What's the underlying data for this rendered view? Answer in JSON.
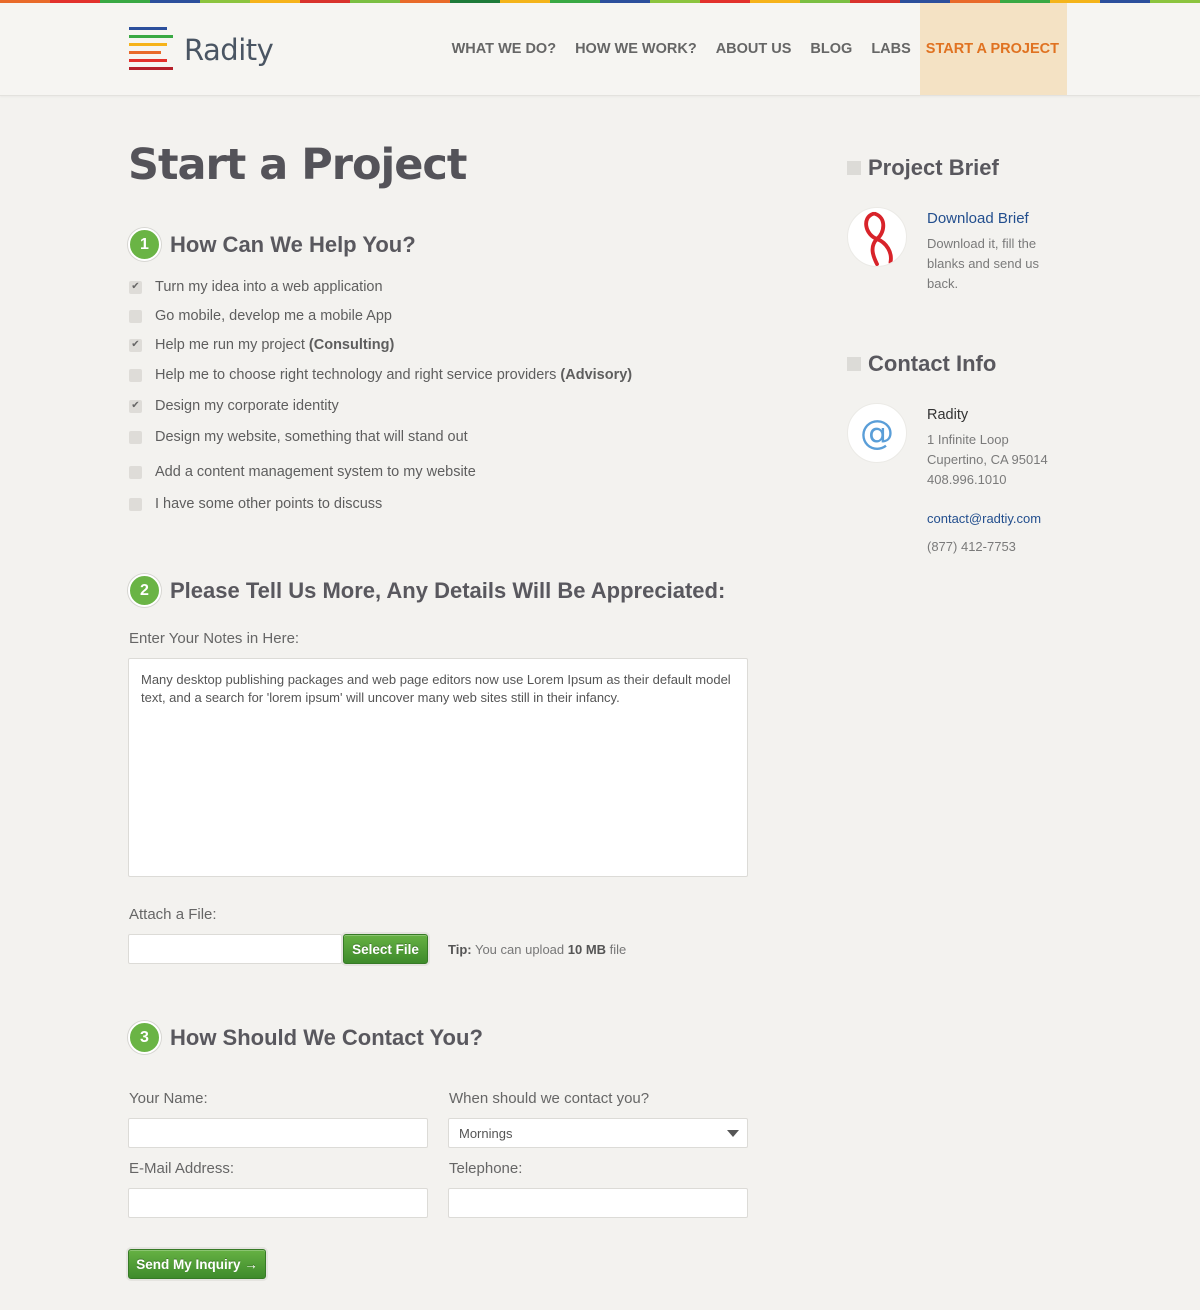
{
  "brand": {
    "name": "Radity",
    "strip_colors": [
      "#e96a2a",
      "#e3312c",
      "#39a944",
      "#2c4f9c",
      "#8cc43f",
      "#f6b31b",
      "#d9332d",
      "#7bbf43",
      "#e96a2a",
      "#1e7b3a",
      "#f4b41a",
      "#39a944",
      "#2c4f9c",
      "#8cc43f",
      "#e3312c",
      "#f6b31b",
      "#7bbf43",
      "#d9332d",
      "#2c4f9c",
      "#e96a2a",
      "#39a944",
      "#f4b41a",
      "#2c4f9c",
      "#8cc43f"
    ],
    "logo_bar_colors": [
      "#2c4f9c",
      "#39a944",
      "#f6b31b",
      "#e96a2a",
      "#e3312c",
      "#b5202b"
    ]
  },
  "nav": {
    "items": [
      "WHAT WE DO?",
      "HOW WE WORK?",
      "ABOUT US",
      "BLOG",
      "LABS"
    ],
    "active": "START A PROJECT"
  },
  "page": {
    "title": "Start a Project"
  },
  "step1": {
    "number": "1",
    "title": "How Can We Help You?",
    "options": [
      {
        "text": "Turn my idea into a web application",
        "bold": "",
        "checked": true
      },
      {
        "text": "Go mobile, develop me a mobile App",
        "bold": "",
        "checked": false
      },
      {
        "text": "Help me run my project ",
        "bold": "(Consulting)",
        "checked": true
      },
      {
        "text": "Help me to choose right technology and right service providers  ",
        "bold": "(Advisory)",
        "checked": false
      },
      {
        "text": "Design my corporate identity",
        "bold": "",
        "checked": true
      },
      {
        "text": "Design my website, something that will stand out",
        "bold": "",
        "checked": false
      },
      {
        "text": "Add a content management system to my website",
        "bold": "",
        "checked": false
      },
      {
        "text": "I have some other points to discuss",
        "bold": "",
        "checked": false
      }
    ]
  },
  "step2": {
    "number": "2",
    "title": "Please Tell Us More, Any Details Will Be Appreciated:",
    "notes_label": "Enter Your Notes in Here:",
    "notes_value": "Many desktop publishing packages and web page editors now use Lorem Ipsum as their default model text, and a search for 'lorem ipsum' will uncover many web sites still in their infancy.",
    "attach_label": "Attach a File:",
    "select_file": "Select File",
    "tip_label": "Tip:",
    "tip_text": " You can upload ",
    "tip_size": "10 MB",
    "tip_suffix": " file"
  },
  "step3": {
    "number": "3",
    "title": "How Should We Contact You?",
    "name_label": "Your Name:",
    "when_label": "When should we contact you?",
    "when_value": "Mornings",
    "email_label": "E-Mail Address:",
    "phone_label": "Telephone:",
    "submit": "Send My Inquiry →"
  },
  "sidebar": {
    "brief_title": "Project Brief",
    "brief_link": "Download Brief",
    "brief_desc_lines": [
      "Download it, fill the",
      "blanks and send us",
      "back."
    ],
    "contact_title": "Contact Info",
    "company": "Radity",
    "address_lines": [
      "1 Infinite Loop",
      "Cupertino, CA 95014",
      "408.996.1010"
    ],
    "email": "contact@radtiy.com",
    "phone": "(877) 412-7753"
  }
}
